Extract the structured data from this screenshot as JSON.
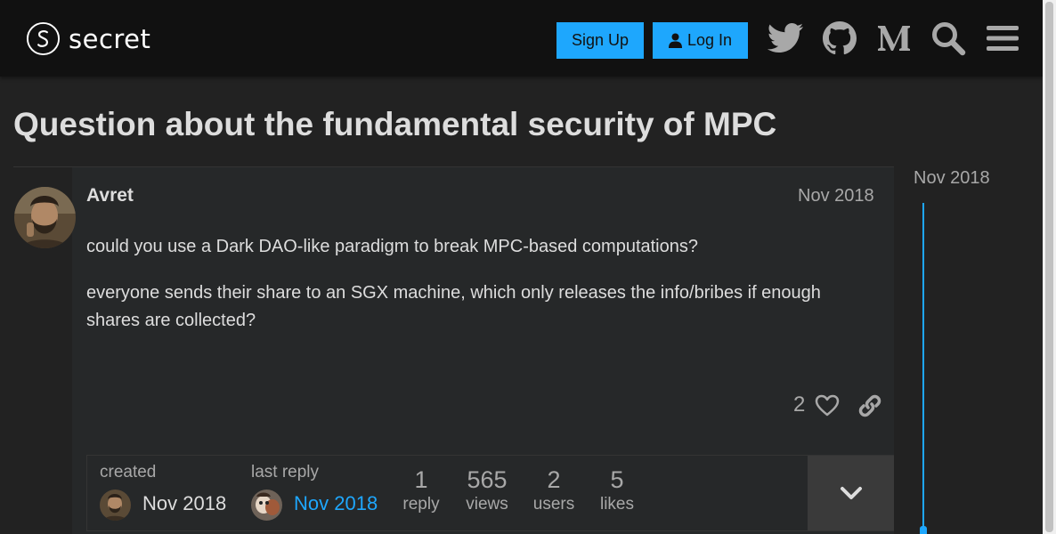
{
  "header": {
    "logo_text": "secret",
    "signup_label": "Sign Up",
    "login_label": "Log In",
    "accent_color": "#1ea7fd",
    "icons": [
      "twitter-icon",
      "github-icon",
      "medium-icon",
      "search-icon",
      "hamburger-menu-icon"
    ]
  },
  "topic": {
    "title": "Question about the fundamental security of MPC"
  },
  "post": {
    "username": "Avret",
    "date": "Nov 2018",
    "paragraphs": [
      "could you use a Dark DAO-like paradigm to break MPC-based computations?",
      "everyone sends their share to an SGX machine, which only releases the info/bribes if enough shares are collected?"
    ],
    "like_count": "2"
  },
  "topic_map": {
    "created_label": "created",
    "created_date": "Nov 2018",
    "last_reply_label": "last reply",
    "last_reply_date": "Nov 2018",
    "stats": [
      {
        "num": "1",
        "label": "reply"
      },
      {
        "num": "565",
        "label": "views"
      },
      {
        "num": "2",
        "label": "users"
      },
      {
        "num": "5",
        "label": "likes"
      }
    ]
  },
  "timeline": {
    "date": "Nov 2018"
  }
}
